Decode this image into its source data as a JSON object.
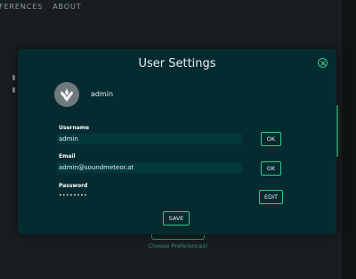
{
  "nav": {
    "items": [
      "FERENCES",
      "ABOUT"
    ]
  },
  "background": {
    "link_text": "Choose Preferences!"
  },
  "modal": {
    "title": "User Settings",
    "close_icon": "close-circle-icon",
    "user": {
      "avatar_icon": "user-logo-icon",
      "name": "admin"
    },
    "fields": {
      "username": {
        "label": "Username",
        "value": "admin",
        "button": "OK"
      },
      "email": {
        "label": "Email",
        "value": "admin@soundmeteor.at",
        "button": "OK"
      },
      "password": {
        "label": "Password",
        "value": "••••••••",
        "button": "EDIT"
      }
    },
    "save_label": "SAVE"
  },
  "colors": {
    "accent": "#35c98a",
    "modal_bg": "#052b30",
    "input_bg": "#03383d"
  }
}
